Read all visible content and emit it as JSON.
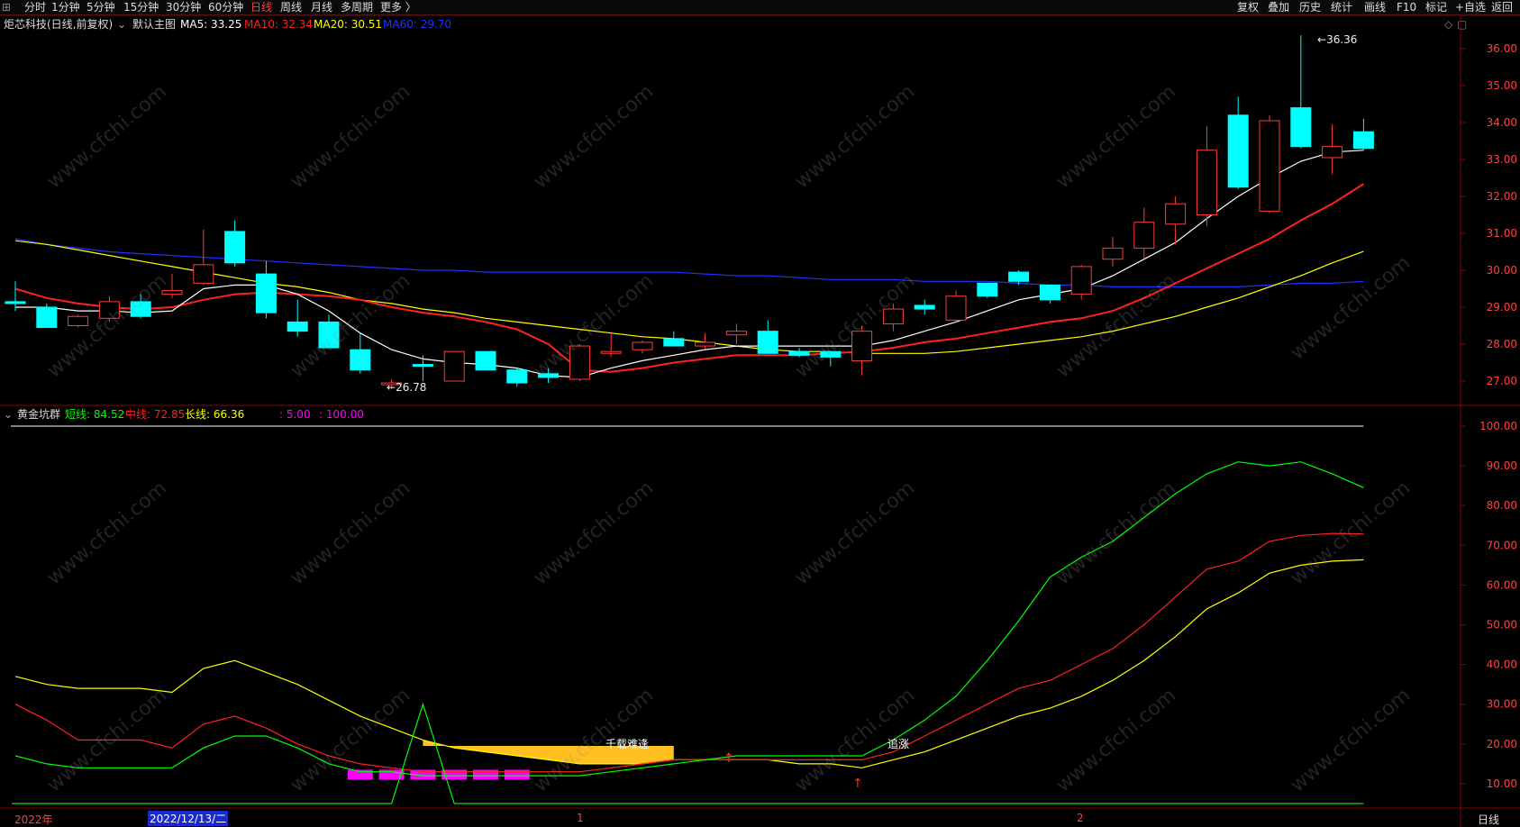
{
  "period_tabs": [
    {
      "label": "分时"
    },
    {
      "label": "1分钟"
    },
    {
      "label": "5分钟"
    },
    {
      "label": "15分钟"
    },
    {
      "label": "30分钟"
    },
    {
      "label": "60分钟"
    },
    {
      "label": "日线",
      "active": true
    },
    {
      "label": "周线"
    },
    {
      "label": "月线"
    },
    {
      "label": "多周期"
    },
    {
      "label": "更多 〉"
    }
  ],
  "right_tools": [
    {
      "label": "复权"
    },
    {
      "label": "叠加"
    },
    {
      "label": "历史"
    },
    {
      "label": "统计"
    },
    {
      "label": "画线"
    },
    {
      "label": "F10"
    },
    {
      "label": "标记"
    },
    {
      "label": "+自选"
    },
    {
      "label": "返回"
    }
  ],
  "stock": {
    "title": "炬芯科技(日线,前复权)",
    "main_chart_label": "默认主图"
  },
  "ma": [
    {
      "label": "MA5: 33.25",
      "color": "#ffffff"
    },
    {
      "label": "MA10: 32.34",
      "color": "#ff2020"
    },
    {
      "label": "MA20: 30.51",
      "color": "#ffff00"
    },
    {
      "label": "MA60: 29.70",
      "color": "#2030ff"
    }
  ],
  "price_axis": {
    "ticks": [
      "36.00",
      "35.00",
      "34.00",
      "33.00",
      "32.00",
      "31.00",
      "30.00",
      "29.00",
      "28.00",
      "27.00"
    ]
  },
  "annotations": {
    "high": "36.36",
    "low": "26.78"
  },
  "indicator": {
    "name": "黄金坑群",
    "short_label": "短线: 84.52",
    "short_color": "#00ff00",
    "mid_label": "中线: 72.85",
    "mid_color": "#ff2020",
    "long_label": "长线: 66.36",
    "long_color": "#ffff00",
    "ref_label": ": 5.00",
    "ref_label2": ": 100.00",
    "ref_color": "#ff00ff",
    "axis": [
      "100.00",
      "90.00",
      "80.00",
      "70.00",
      "60.00",
      "50.00",
      "40.00",
      "30.00",
      "20.00",
      "10.00"
    ],
    "text_qianzai": "千载难逢",
    "text_zhuizhang": "追涨"
  },
  "bottom": {
    "year": "2022年",
    "date": "2022/12/13/二",
    "m1": "1",
    "m2": "2",
    "period": "日线"
  },
  "watermark": "www.cfchi.com",
  "chart_data": {
    "type": "line",
    "candles": [
      {
        "o": 29.15,
        "h": 29.7,
        "l": 28.9,
        "c": 29.1
      },
      {
        "o": 29.0,
        "h": 29.1,
        "l": 28.45,
        "c": 28.45
      },
      {
        "o": 28.5,
        "h": 28.8,
        "l": 28.45,
        "c": 28.75
      },
      {
        "o": 28.7,
        "h": 29.3,
        "l": 28.6,
        "c": 29.15
      },
      {
        "o": 29.15,
        "h": 29.35,
        "l": 28.7,
        "c": 28.75
      },
      {
        "o": 29.35,
        "h": 29.9,
        "l": 29.25,
        "c": 29.45
      },
      {
        "o": 29.65,
        "h": 31.1,
        "l": 29.6,
        "c": 30.15
      },
      {
        "o": 31.05,
        "h": 31.35,
        "l": 30.1,
        "c": 30.2
      },
      {
        "o": 29.9,
        "h": 30.25,
        "l": 28.7,
        "c": 28.85
      },
      {
        "o": 28.6,
        "h": 29.2,
        "l": 28.2,
        "c": 28.35
      },
      {
        "o": 28.6,
        "h": 28.8,
        "l": 27.9,
        "c": 27.9
      },
      {
        "o": 27.85,
        "h": 28.3,
        "l": 27.2,
        "c": 27.3
      },
      {
        "o": 26.95,
        "h": 27.05,
        "l": 26.78,
        "c": 26.95
      },
      {
        "o": 27.45,
        "h": 27.7,
        "l": 27.0,
        "c": 27.4
      },
      {
        "o": 27.0,
        "h": 27.7,
        "l": 27.05,
        "c": 27.8
      },
      {
        "o": 27.8,
        "h": 27.75,
        "l": 27.3,
        "c": 27.3
      },
      {
        "o": 27.3,
        "h": 27.35,
        "l": 26.85,
        "c": 26.95
      },
      {
        "o": 27.2,
        "h": 27.35,
        "l": 26.95,
        "c": 27.1
      },
      {
        "o": 27.05,
        "h": 28.0,
        "l": 27.0,
        "c": 27.95
      },
      {
        "o": 27.8,
        "h": 28.3,
        "l": 27.65,
        "c": 27.8
      },
      {
        "o": 27.85,
        "h": 28.1,
        "l": 27.75,
        "c": 28.05
      },
      {
        "o": 28.15,
        "h": 28.35,
        "l": 27.95,
        "c": 27.95
      },
      {
        "o": 27.95,
        "h": 28.3,
        "l": 27.85,
        "c": 28.05
      },
      {
        "o": 28.25,
        "h": 28.55,
        "l": 28.0,
        "c": 28.35
      },
      {
        "o": 28.35,
        "h": 28.65,
        "l": 27.75,
        "c": 27.75
      },
      {
        "o": 27.8,
        "h": 27.9,
        "l": 27.65,
        "c": 27.7
      },
      {
        "o": 27.8,
        "h": 27.75,
        "l": 27.4,
        "c": 27.65
      },
      {
        "o": 27.55,
        "h": 28.5,
        "l": 27.15,
        "c": 28.35
      },
      {
        "o": 28.55,
        "h": 29.1,
        "l": 28.35,
        "c": 28.95
      },
      {
        "o": 29.05,
        "h": 29.2,
        "l": 28.8,
        "c": 28.95
      },
      {
        "o": 28.65,
        "h": 29.45,
        "l": 28.6,
        "c": 29.3
      },
      {
        "o": 29.65,
        "h": 29.65,
        "l": 29.25,
        "c": 29.3
      },
      {
        "o": 29.95,
        "h": 30.0,
        "l": 29.6,
        "c": 29.7
      },
      {
        "o": 29.6,
        "h": 29.6,
        "l": 29.1,
        "c": 29.2
      },
      {
        "o": 29.35,
        "h": 30.15,
        "l": 29.2,
        "c": 30.1
      },
      {
        "o": 30.3,
        "h": 30.9,
        "l": 30.1,
        "c": 30.6
      },
      {
        "o": 30.6,
        "h": 31.7,
        "l": 30.3,
        "c": 31.3
      },
      {
        "o": 31.25,
        "h": 32.0,
        "l": 30.7,
        "c": 31.8
      },
      {
        "o": 31.5,
        "h": 33.9,
        "l": 31.2,
        "c": 33.25
      },
      {
        "o": 34.2,
        "h": 34.7,
        "l": 32.2,
        "c": 32.25
      },
      {
        "o": 31.6,
        "h": 34.2,
        "l": 31.55,
        "c": 34.05
      },
      {
        "o": 34.4,
        "h": 36.36,
        "l": 33.3,
        "c": 33.35
      },
      {
        "o": 33.05,
        "h": 33.95,
        "l": 32.6,
        "c": 33.35
      },
      {
        "o": 33.75,
        "h": 34.1,
        "l": 33.25,
        "c": 33.3
      }
    ],
    "ma5": [
      29.0,
      29.0,
      28.9,
      28.9,
      28.85,
      28.9,
      29.5,
      29.6,
      29.6,
      29.35,
      28.9,
      28.3,
      27.85,
      27.6,
      27.5,
      27.45,
      27.35,
      27.15,
      27.1,
      27.35,
      27.55,
      27.7,
      27.85,
      27.95,
      27.95,
      27.95,
      27.95,
      27.95,
      28.1,
      28.35,
      28.6,
      28.9,
      29.2,
      29.35,
      29.5,
      29.85,
      30.3,
      30.75,
      31.4,
      32.0,
      32.5,
      32.95,
      33.2,
      33.25
    ],
    "ma10": [
      29.5,
      29.25,
      29.1,
      29.0,
      28.95,
      29.0,
      29.2,
      29.35,
      29.4,
      29.35,
      29.3,
      29.2,
      29.0,
      28.85,
      28.75,
      28.6,
      28.4,
      28.0,
      27.3,
      27.25,
      27.35,
      27.5,
      27.6,
      27.7,
      27.7,
      27.7,
      27.75,
      27.8,
      27.9,
      28.05,
      28.15,
      28.3,
      28.45,
      28.6,
      28.7,
      28.9,
      29.25,
      29.65,
      30.05,
      30.45,
      30.85,
      31.35,
      31.8,
      32.34
    ],
    "ma20": [
      30.8,
      30.7,
      30.55,
      30.4,
      30.25,
      30.1,
      29.95,
      29.8,
      29.65,
      29.55,
      29.4,
      29.2,
      29.1,
      28.95,
      28.85,
      28.7,
      28.6,
      28.5,
      28.4,
      28.3,
      28.2,
      28.15,
      28.05,
      27.95,
      27.85,
      27.8,
      27.8,
      27.75,
      27.75,
      27.75,
      27.8,
      27.9,
      28.0,
      28.1,
      28.2,
      28.35,
      28.55,
      28.75,
      29.0,
      29.25,
      29.55,
      29.85,
      30.2,
      30.51
    ],
    "ma60": [
      30.85,
      30.7,
      30.6,
      30.5,
      30.45,
      30.4,
      30.35,
      30.3,
      30.25,
      30.2,
      30.15,
      30.1,
      30.05,
      30.0,
      30.0,
      29.95,
      29.95,
      29.95,
      29.95,
      29.95,
      29.95,
      29.95,
      29.9,
      29.85,
      29.85,
      29.8,
      29.75,
      29.75,
      29.75,
      29.7,
      29.7,
      29.7,
      29.65,
      29.6,
      29.6,
      29.55,
      29.55,
      29.55,
      29.55,
      29.55,
      29.6,
      29.65,
      29.65,
      29.7
    ],
    "ind_short": [
      17,
      15,
      14,
      14,
      14,
      14,
      19,
      22,
      22,
      19,
      15,
      13,
      13,
      12,
      12,
      12,
      12,
      12,
      12,
      13,
      14,
      15,
      16,
      17,
      17,
      17,
      17,
      17,
      21,
      26,
      32,
      41,
      51,
      62,
      67,
      71,
      77,
      83,
      88,
      91,
      90,
      91,
      88,
      84.52
    ],
    "ind_mid": [
      30,
      26,
      21,
      21,
      21,
      19,
      25,
      27,
      24,
      20,
      17,
      15,
      14,
      13,
      13,
      13,
      13,
      13,
      13,
      14,
      15,
      16,
      16,
      16,
      16,
      16,
      16,
      16,
      18,
      22,
      26,
      30,
      34,
      36,
      40,
      44,
      50,
      57,
      64,
      66,
      71,
      72.5,
      73,
      72.85
    ],
    "ind_long": [
      37,
      35,
      34,
      34,
      34,
      33,
      39,
      41,
      38,
      35,
      31,
      27,
      24,
      21,
      19,
      18,
      17,
      16,
      15,
      15,
      15,
      16,
      16,
      16,
      16,
      15,
      15,
      14,
      16,
      18,
      21,
      24,
      27,
      29,
      32,
      36,
      41,
      47,
      54,
      58,
      63,
      65,
      66,
      66.36
    ],
    "ind_ref_high": 100,
    "ind_ref_low": 5
  }
}
